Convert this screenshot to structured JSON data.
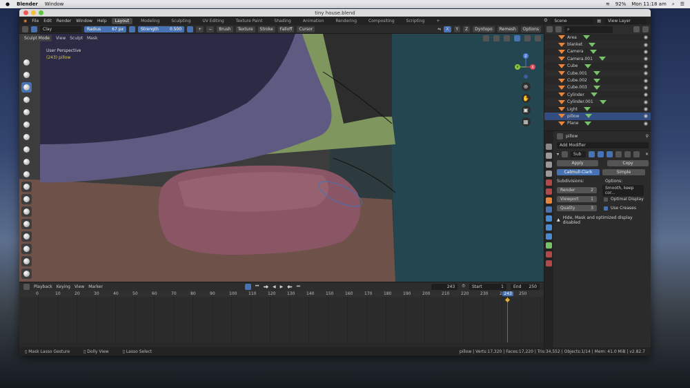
{
  "mac_menu": {
    "app": "Blender",
    "window": "Window",
    "battery": "92%",
    "clock": "Mon 11:18 am"
  },
  "window": {
    "title": "tiny house.blend"
  },
  "topbar": {
    "menus": [
      "File",
      "Edit",
      "Render",
      "Window",
      "Help"
    ],
    "workspaces": [
      "Layout",
      "Modeling",
      "Sculpting",
      "UV Editing",
      "Texture Paint",
      "Shading",
      "Animation",
      "Rendering",
      "Compositing",
      "Scripting",
      "+"
    ],
    "scene": "Scene",
    "view_layer": "View Layer"
  },
  "tool_header": {
    "brush": "Clay",
    "radius_label": "Radius",
    "radius_value": "67 px",
    "strength_label": "Strength",
    "strength_value": "0.500",
    "plus": "+",
    "minus": "−",
    "menus": [
      "Brush",
      "Texture",
      "Stroke",
      "Falloff",
      "Cursor"
    ],
    "axes": [
      "X",
      "Y",
      "Z"
    ],
    "dyntopo": "Dyntopo",
    "remesh": "Remesh",
    "options": "Options"
  },
  "viewport": {
    "mode": "Sculpt Mode",
    "menus": [
      "View",
      "Sculpt",
      "Mask"
    ],
    "view_name": "User Perspective",
    "object_info": "(243) pillow",
    "gizmo": {
      "z": "Z",
      "y": "Y",
      "x": "X"
    }
  },
  "outliner": {
    "items": [
      {
        "name": "Area"
      },
      {
        "name": "blanket"
      },
      {
        "name": "Camera"
      },
      {
        "name": "Camera.001"
      },
      {
        "name": "Cube"
      },
      {
        "name": "Cube.001"
      },
      {
        "name": "Cube.002"
      },
      {
        "name": "Cube.003"
      },
      {
        "name": "Cylinder"
      },
      {
        "name": "Cylinder.001"
      },
      {
        "name": "Light"
      },
      {
        "name": "pillow"
      },
      {
        "name": "Plane"
      }
    ],
    "selected_index": 11
  },
  "properties": {
    "object": "pillow",
    "add_modifier": "Add Modifier",
    "modifier_name": "Sub",
    "apply": "Apply",
    "copy": "Copy",
    "catmull": "Catmull-Clark",
    "simple": "Simple",
    "subdivisions": "Subdivisions:",
    "options_label": "Options:",
    "render_label": "Render",
    "render_value": "2",
    "viewport_label": "Viewport",
    "viewport_value": "1",
    "quality_label": "Quality",
    "quality_value": "3",
    "uv_smooth": "Smooth, keep cor...",
    "optimal_display": "Optimal Display",
    "use_creases": "Use Creases",
    "warning": "Hide, Mask and optimized display disabled"
  },
  "timeline": {
    "menus": [
      "Playback",
      "Keying",
      "View",
      "Marker"
    ],
    "current_frame": "243",
    "start_label": "Start",
    "start_value": "1",
    "end_label": "End",
    "end_value": "250",
    "ticks": [
      0,
      10,
      20,
      30,
      40,
      50,
      60,
      70,
      80,
      90,
      100,
      110,
      120,
      130,
      140,
      150,
      160,
      170,
      180,
      190,
      200,
      210,
      220,
      230,
      240,
      250
    ]
  },
  "statusbar": {
    "left1": "Mask Lasso Gesture",
    "left2": "Dolly View",
    "left3": "Lasso Select",
    "right": "pillow | Verts:17,320 | Faces:17,220 | Tris:34,552 | Objects:1/14 | Mem: 41.0 MiB | v2.82.7"
  },
  "colors": {
    "accent": "#4772b3",
    "pillow": "#8a5565",
    "blanket": "#4b4566",
    "wall": "#244650",
    "floor": "#6e5148",
    "green": "#7f965e"
  }
}
